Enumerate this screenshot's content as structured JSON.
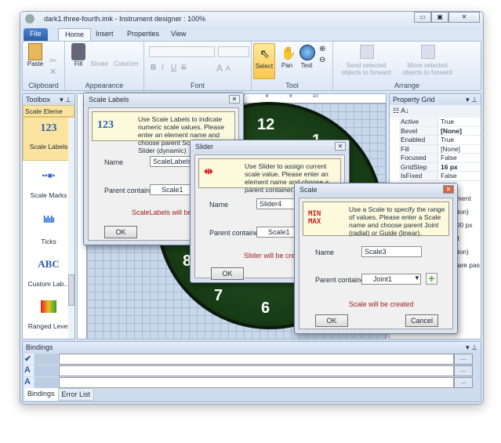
{
  "window": {
    "title": "dark1.three-fourth.imk - Instrument designer : 100%",
    "minimize": "▭",
    "maximize": "▣",
    "close": "✕"
  },
  "ribbon": {
    "tabs": [
      "File",
      "Home",
      "Insert",
      "Properties",
      "View"
    ],
    "groups": {
      "clipboard": "Clipboard",
      "appearance": "Appearance",
      "font": "Font",
      "tool": "Tool",
      "arrange": "Arrange"
    },
    "buttons": {
      "paste": "Paste",
      "fill": "Fill",
      "stroke": "Stroke",
      "colorizer": "Colorizer",
      "bold": "B",
      "italic": "I",
      "underline": "U",
      "strike": "S",
      "grow": "A",
      "shrink": "A",
      "select": "Select",
      "pan": "Pan",
      "test": "Test",
      "send": "Send selected objects to forward",
      "move": "Move selected objects to forward"
    }
  },
  "toolbox": {
    "title": "Toolbox",
    "category": "Scale Eleme",
    "items": [
      {
        "label": "Scale Labels",
        "icon": "123"
      },
      {
        "label": "Scale Marks"
      },
      {
        "label": "Ticks"
      },
      {
        "label": "Custom Lab...",
        "icon": "ABC"
      },
      {
        "label": "Ranged Level"
      }
    ]
  },
  "canvas": {
    "ruler": [
      "1",
      "2",
      "3",
      "4",
      "5",
      "6",
      "7",
      "8",
      "9",
      "10"
    ],
    "clock_numbers": {
      "n12": "12",
      "n1": "1",
      "n8": "8",
      "n7": "7",
      "n6": "6"
    }
  },
  "property_grid": {
    "title": "Property Grid",
    "rows": [
      [
        "Active",
        "True"
      ],
      [
        "Bevel",
        "[None]"
      ],
      [
        "Enabled",
        "True"
      ],
      [
        "Fill",
        "[None]"
      ],
      [
        "Focused",
        "False"
      ],
      [
        "GridStep",
        "16 px"
      ],
      [
        "IsFixed",
        "False"
      ]
    ],
    "partial": [
      "ument",
      "ction)",
      "400 px",
      "ult",
      "ction)",
      "s are pas"
    ]
  },
  "dialogs": {
    "scale_labels": {
      "title": "Scale Labels",
      "icon": "123",
      "info": "Use Scale Labels to indicate numeric scale values. Please enter an element name and choose parent Scale (static) or Slider (dynamic)",
      "name_label": "Name",
      "name_value": "ScaleLabels2",
      "parent_label": "Parent container",
      "parent_value": "Scale1",
      "status": "ScaleLabels will be create",
      "ok": "OK"
    },
    "slider": {
      "title": "Slider",
      "info": "Use Slider to assign current scale value. Please enter an element name and choose a parent container.",
      "name_label": "Name",
      "name_value": "Slider4",
      "parent_label": "Parent container",
      "parent_value": "Scale1",
      "status": "Slider will be create",
      "ok": "OK"
    },
    "scale": {
      "title": "Scale",
      "icon": "MIN MAX",
      "info": "Use a Scale to specify the range of values. Please enter a Scale name and choose parent Joint (radial) or Guide (linear).",
      "name_label": "Name",
      "name_value": "Scale3",
      "parent_label": "Parent container",
      "parent_value": "Joint1",
      "status": "Scale will be created",
      "ok": "OK",
      "cancel": "Cancel"
    }
  },
  "bindings": {
    "title": "Bindings",
    "tabs": [
      "Bindings",
      "Error List"
    ],
    "ellipsis": "..."
  }
}
